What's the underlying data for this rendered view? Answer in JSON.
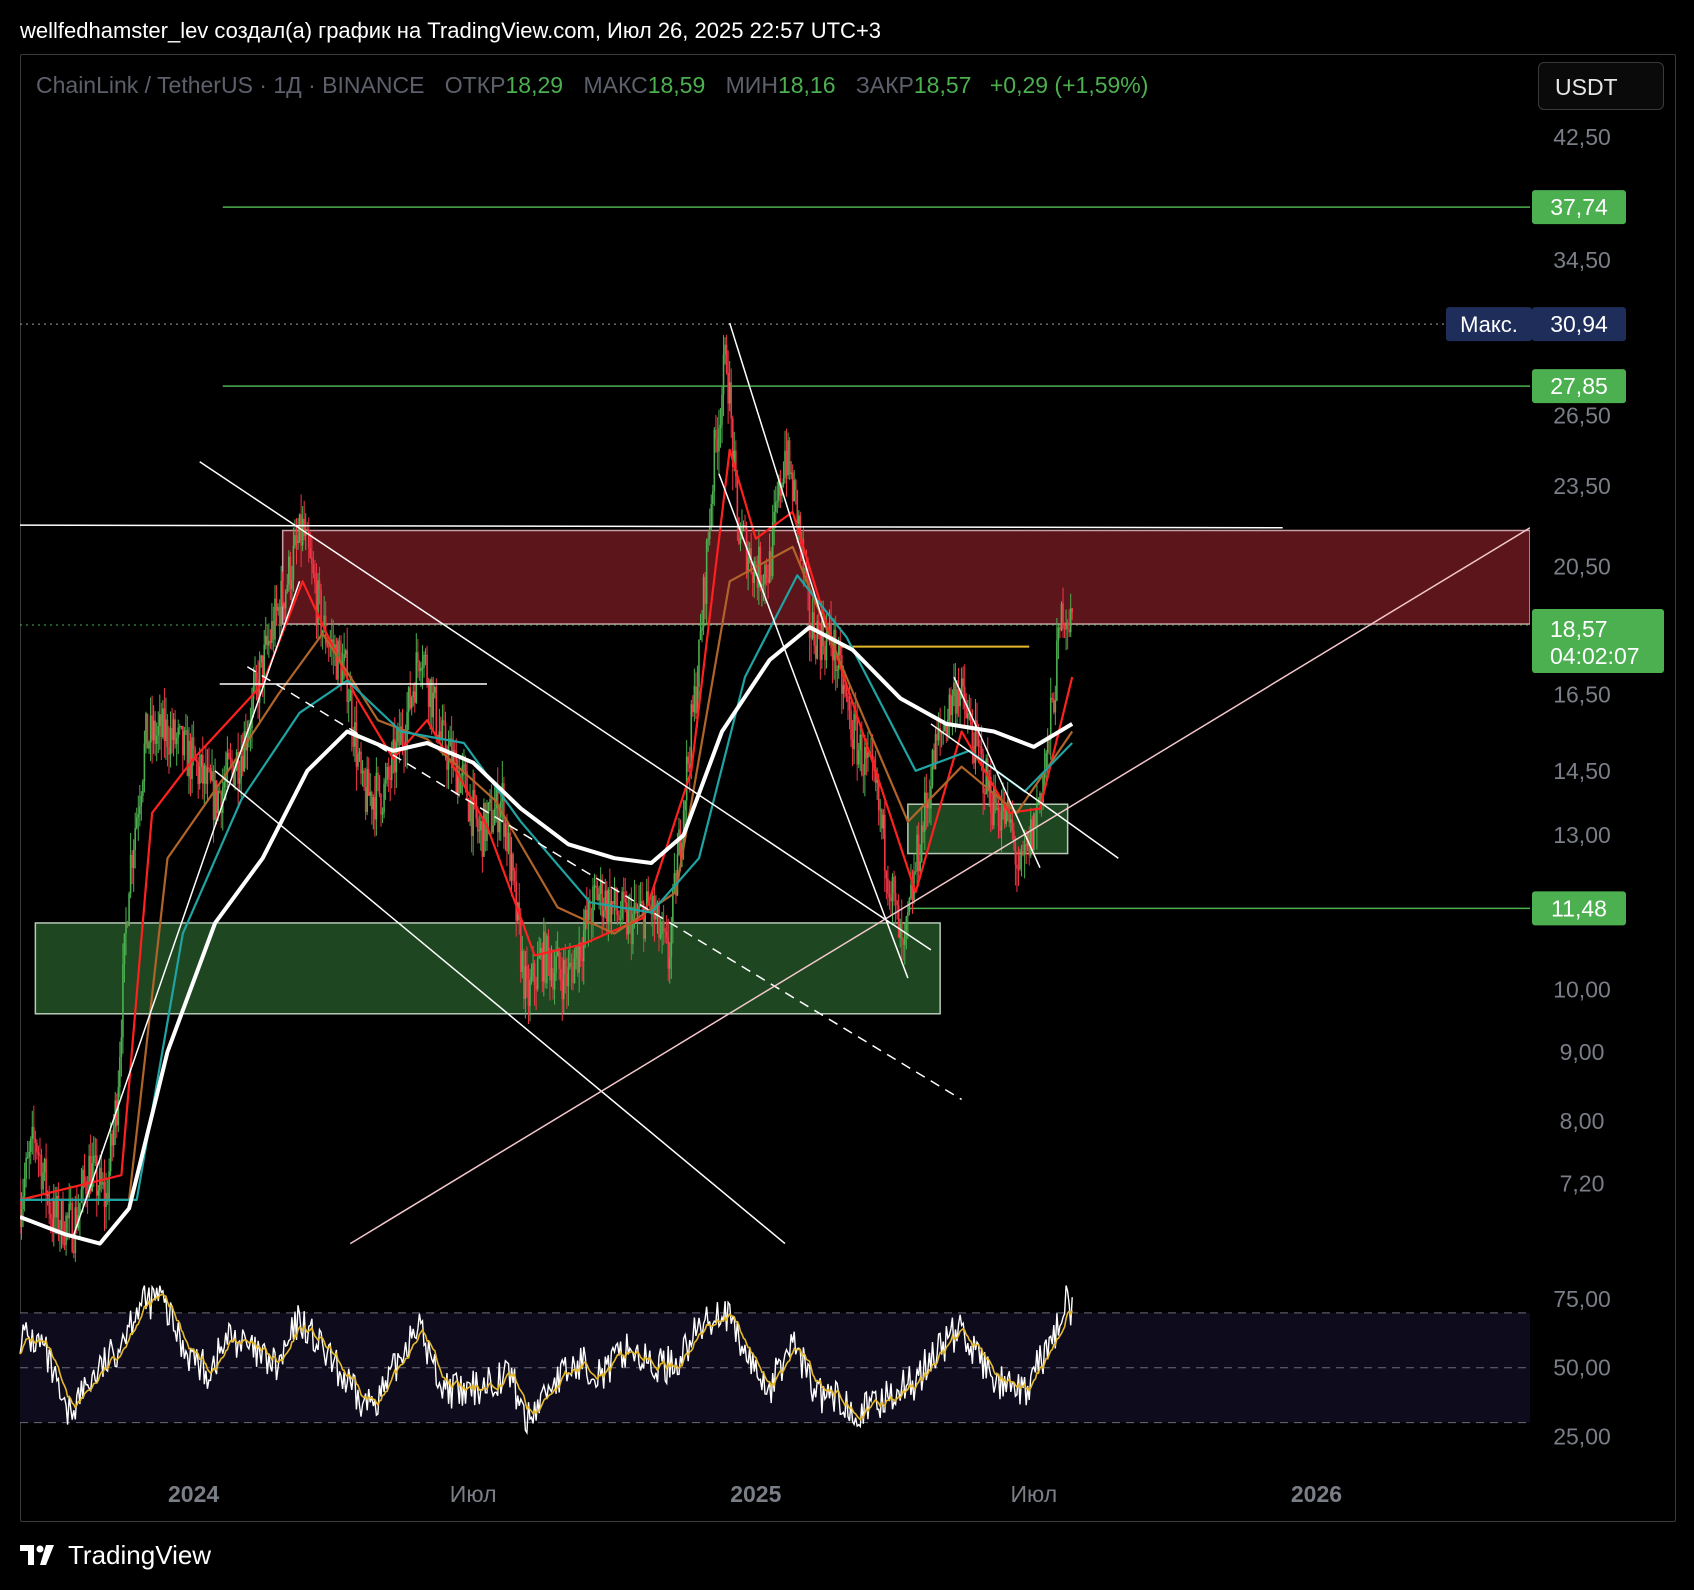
{
  "header": {
    "caption": "wellfedhamster_lev создал(а) график на TradingView.com, Июл 26, 2025 22:57 UTC+3"
  },
  "legend": {
    "symbol": "ChainLink / TetherUS · 1Д · BINANCE",
    "open_label": "ОТКР",
    "open": "18,29",
    "high_label": "МАКС",
    "high": "18,59",
    "low_label": "МИН",
    "low": "18,16",
    "close_label": "ЗАКР",
    "close": "18,57",
    "change": "+0,29 (+1,59%)"
  },
  "currency_button": "USDT",
  "footer": {
    "brand": "TradingView"
  },
  "colors": {
    "up": "#4caf50",
    "down": "#f23645",
    "resistance_zone": "#5c151b",
    "support_zone": "#1e4620",
    "label_green": "#4caf50",
    "label_max": "#1e2d5a",
    "ema_fast": "#ff2020",
    "ema_mid": "#b0642a",
    "ema_slow": "#1fa3a3",
    "ma_white": "#ffffff",
    "rsi_line": "#ffffff",
    "rsi_signal": "#e5b92c",
    "rsi_band": "#0e0c1c"
  },
  "chart_data": {
    "type": "candlestick",
    "title": "",
    "y_scale": "log",
    "y_tick_labels": [
      "42,50",
      "34,50",
      "26,50",
      "23,50",
      "20,50",
      "16,50",
      "14,50",
      "13,00",
      "10,00",
      "9,00",
      "8,00",
      "7,20"
    ],
    "y_ticks": [
      42.5,
      34.5,
      26.5,
      23.5,
      20.5,
      16.5,
      14.5,
      13.0,
      10.0,
      9.0,
      8.0,
      7.2
    ],
    "x_tick_labels": [
      "2024",
      "Июл",
      "2025",
      "Июл",
      "2026"
    ],
    "x_ticks": [
      "2024-01-01",
      "2024-07-01",
      "2025-01-01",
      "2025-07-01",
      "2026-01-01"
    ],
    "x_range": [
      "2023-09-10",
      "2026-05-20"
    ],
    "price_path": [
      [
        "2023-09-10",
        7.0
      ],
      [
        "2023-09-20",
        7.8
      ],
      [
        "2023-10-01",
        6.8
      ],
      [
        "2023-10-15",
        6.7
      ],
      [
        "2023-10-25",
        7.4
      ],
      [
        "2023-11-05",
        7.0
      ],
      [
        "2023-11-12",
        8.3
      ],
      [
        "2023-11-20",
        12.2
      ],
      [
        "2023-12-01",
        15.3
      ],
      [
        "2023-12-15",
        15.5
      ],
      [
        "2024-01-01",
        14.7
      ],
      [
        "2024-01-15",
        13.8
      ],
      [
        "2024-02-01",
        15.0
      ],
      [
        "2024-02-20",
        18.2
      ],
      [
        "2024-03-05",
        20.6
      ],
      [
        "2024-03-12",
        21.8
      ],
      [
        "2024-03-25",
        18.5
      ],
      [
        "2024-04-10",
        17.0
      ],
      [
        "2024-04-20",
        13.9
      ],
      [
        "2024-05-05",
        14.0
      ],
      [
        "2024-05-20",
        16.1
      ],
      [
        "2024-05-28",
        18.0
      ],
      [
        "2024-06-10",
        15.3
      ],
      [
        "2024-06-25",
        14.2
      ],
      [
        "2024-07-05",
        13.0
      ],
      [
        "2024-07-20",
        13.8
      ],
      [
        "2024-08-05",
        9.8
      ],
      [
        "2024-08-15",
        10.6
      ],
      [
        "2024-09-01",
        10.2
      ],
      [
        "2024-09-20",
        11.8
      ],
      [
        "2024-10-10",
        11.2
      ],
      [
        "2024-10-25",
        11.5
      ],
      [
        "2024-11-05",
        10.5
      ],
      [
        "2024-11-15",
        13.8
      ],
      [
        "2024-11-25",
        17.5
      ],
      [
        "2024-12-05",
        24.8
      ],
      [
        "2024-12-13",
        29.5
      ],
      [
        "2024-12-20",
        22.0
      ],
      [
        "2025-01-01",
        20.4
      ],
      [
        "2025-01-10",
        20.5
      ],
      [
        "2025-01-20",
        25.0
      ],
      [
        "2025-01-28",
        22.5
      ],
      [
        "2025-02-05",
        18.5
      ],
      [
        "2025-02-20",
        18.0
      ],
      [
        "2025-03-05",
        15.5
      ],
      [
        "2025-03-20",
        14.0
      ],
      [
        "2025-04-07",
        10.5
      ],
      [
        "2025-04-15",
        12.3
      ],
      [
        "2025-04-28",
        15.0
      ],
      [
        "2025-05-12",
        16.8
      ],
      [
        "2025-05-25",
        15.0
      ],
      [
        "2025-06-05",
        13.7
      ],
      [
        "2025-06-15",
        13.3
      ],
      [
        "2025-06-22",
        12.1
      ],
      [
        "2025-07-01",
        13.2
      ],
      [
        "2025-07-10",
        15.0
      ],
      [
        "2025-07-20",
        19.2
      ],
      [
        "2025-07-26",
        18.57
      ]
    ],
    "moving_averages": [
      {
        "color_key": "ema_fast",
        "points": [
          [
            "2023-09-10",
            7.0
          ],
          [
            "2023-11-15",
            7.3
          ],
          [
            "2023-12-05",
            13.5
          ],
          [
            "2024-01-01",
            14.8
          ],
          [
            "2024-02-15",
            16.8
          ],
          [
            "2024-03-12",
            20.0
          ],
          [
            "2024-04-15",
            16.5
          ],
          [
            "2024-05-10",
            14.8
          ],
          [
            "2024-06-01",
            15.8
          ],
          [
            "2024-07-10",
            13.2
          ],
          [
            "2024-08-10",
            10.6
          ],
          [
            "2024-09-10",
            10.8
          ],
          [
            "2024-10-20",
            11.3
          ],
          [
            "2024-11-20",
            14.5
          ],
          [
            "2024-12-15",
            25.0
          ],
          [
            "2025-01-01",
            21.5
          ],
          [
            "2025-01-25",
            22.5
          ],
          [
            "2025-02-20",
            18.0
          ],
          [
            "2025-03-20",
            14.5
          ],
          [
            "2025-04-15",
            11.8
          ],
          [
            "2025-05-15",
            15.5
          ],
          [
            "2025-06-15",
            13.5
          ],
          [
            "2025-07-05",
            13.6
          ],
          [
            "2025-07-26",
            17.0
          ]
        ]
      },
      {
        "color_key": "ema_mid",
        "points": [
          [
            "2023-09-10",
            7.0
          ],
          [
            "2023-11-20",
            7.0
          ],
          [
            "2023-12-15",
            12.5
          ],
          [
            "2024-01-20",
            14.3
          ],
          [
            "2024-02-25",
            16.5
          ],
          [
            "2024-03-25",
            18.3
          ],
          [
            "2024-04-30",
            15.8
          ],
          [
            "2024-06-01",
            15.3
          ],
          [
            "2024-07-15",
            13.8
          ],
          [
            "2024-08-25",
            11.5
          ],
          [
            "2024-10-01",
            11.0
          ],
          [
            "2024-11-10",
            11.8
          ],
          [
            "2024-12-15",
            20.0
          ],
          [
            "2025-01-25",
            21.2
          ],
          [
            "2025-03-01",
            17.0
          ],
          [
            "2025-04-10",
            13.3
          ],
          [
            "2025-05-15",
            14.6
          ],
          [
            "2025-06-20",
            13.5
          ],
          [
            "2025-07-26",
            15.5
          ]
        ]
      },
      {
        "color_key": "ema_slow",
        "points": [
          [
            "2023-09-10",
            7.0
          ],
          [
            "2023-11-25",
            7.0
          ],
          [
            "2023-12-25",
            11.0
          ],
          [
            "2024-02-01",
            13.8
          ],
          [
            "2024-03-10",
            16.0
          ],
          [
            "2024-04-10",
            16.9
          ],
          [
            "2024-05-15",
            15.5
          ],
          [
            "2024-06-25",
            15.2
          ],
          [
            "2024-08-01",
            13.3
          ],
          [
            "2024-09-15",
            11.6
          ],
          [
            "2024-10-25",
            11.4
          ],
          [
            "2024-11-25",
            12.5
          ],
          [
            "2024-12-25",
            17.0
          ],
          [
            "2025-01-28",
            20.2
          ],
          [
            "2025-03-01",
            18.2
          ],
          [
            "2025-04-15",
            14.5
          ],
          [
            "2025-05-20",
            15.0
          ],
          [
            "2025-06-25",
            14.0
          ],
          [
            "2025-07-26",
            15.2
          ]
        ]
      },
      {
        "color_key": "ma_white",
        "points": [
          [
            "2023-09-10",
            6.8
          ],
          [
            "2023-10-10",
            6.6
          ],
          [
            "2023-11-01",
            6.5
          ],
          [
            "2023-11-20",
            6.9
          ],
          [
            "2023-12-15",
            9.0
          ],
          [
            "2024-01-15",
            11.2
          ],
          [
            "2024-02-15",
            12.5
          ],
          [
            "2024-03-15",
            14.5
          ],
          [
            "2024-04-10",
            15.5
          ],
          [
            "2024-05-10",
            15.0
          ],
          [
            "2024-06-01",
            15.2
          ],
          [
            "2024-07-01",
            14.7
          ],
          [
            "2024-08-01",
            13.6
          ],
          [
            "2024-09-01",
            12.8
          ],
          [
            "2024-10-01",
            12.5
          ],
          [
            "2024-10-25",
            12.4
          ],
          [
            "2024-11-15",
            13.0
          ],
          [
            "2024-12-10",
            15.5
          ],
          [
            "2025-01-10",
            17.5
          ],
          [
            "2025-02-05",
            18.5
          ],
          [
            "2025-03-05",
            17.8
          ],
          [
            "2025-04-05",
            16.4
          ],
          [
            "2025-05-05",
            15.7
          ],
          [
            "2025-06-05",
            15.5
          ],
          [
            "2025-07-01",
            15.1
          ],
          [
            "2025-07-26",
            15.7
          ]
        ]
      }
    ],
    "horizontal_lines": [
      {
        "price": 37.74,
        "start": "2024-01-20",
        "label": "37,74",
        "style": "green"
      },
      {
        "price": 27.85,
        "start": "2024-01-20",
        "label": "27,85",
        "style": "green"
      },
      {
        "price": 11.48,
        "start": "2025-04-10",
        "label": "11,48",
        "style": "green"
      }
    ],
    "max_marker": {
      "price": 30.94,
      "prefix": "Макс.",
      "label": "30,94"
    },
    "current_price": {
      "price": 18.57,
      "label": "18,57",
      "countdown": "04:02:07"
    },
    "zones": [
      {
        "kind": "resistance",
        "from": "2024-02-28",
        "to": "2026-05-20",
        "low": 18.6,
        "high": 21.8
      },
      {
        "kind": "support",
        "from": "2023-09-20",
        "to": "2025-05-01",
        "low": 9.6,
        "high": 11.2
      },
      {
        "kind": "support",
        "from": "2025-04-10",
        "to": "2025-07-23",
        "low": 12.6,
        "high": 13.7
      }
    ],
    "trendlines": [
      {
        "from": [
          "2023-09-10",
          22.0
        ],
        "to": [
          "2025-12-10",
          21.9
        ],
        "style": "solid"
      },
      {
        "from": [
          "2024-01-05",
          24.5
        ],
        "to": [
          "2025-04-25",
          10.7
        ],
        "style": "solid"
      },
      {
        "from": [
          "2024-01-15",
          14.5
        ],
        "to": [
          "2025-01-20",
          6.5
        ],
        "style": "solid"
      },
      {
        "from": [
          "2024-02-05",
          17.3
        ],
        "to": [
          "2025-05-15",
          8.3
        ],
        "style": "dashed"
      },
      {
        "from": [
          "2024-04-12",
          6.5
        ],
        "to": [
          "2026-05-20",
          21.9
        ],
        "style": "solid"
      },
      {
        "from": [
          "2023-10-15",
          6.6
        ],
        "to": [
          "2024-03-10",
          20.0
        ],
        "style": "solid"
      },
      {
        "from": [
          "2024-12-08",
          24.0
        ],
        "to": [
          "2025-04-10",
          10.2
        ],
        "style": "solid"
      },
      {
        "from": [
          "2024-12-15",
          31.0
        ],
        "to": [
          "2025-02-15",
          18.5
        ],
        "style": "solid"
      },
      {
        "from": [
          "2024-01-18",
          16.8
        ],
        "to": [
          "2024-07-10",
          16.8
        ],
        "style": "solid"
      },
      {
        "from": [
          "2025-04-25",
          15.7
        ],
        "to": [
          "2025-08-25",
          12.5
        ],
        "style": "solid"
      },
      {
        "from": [
          "2025-05-10",
          17.0
        ],
        "to": [
          "2025-07-05",
          12.3
        ],
        "style": "solid"
      }
    ],
    "yellow_level": {
      "price": 17.9,
      "from": "2025-02-25",
      "to": "2025-06-28"
    },
    "rsi": {
      "tick_labels": [
        "75,00",
        "50,00",
        "25,00"
      ],
      "ticks": [
        75,
        50,
        25
      ],
      "band": [
        30,
        70
      ],
      "range": [
        20,
        82
      ],
      "path": [
        [
          "2023-09-10",
          62
        ],
        [
          "2023-09-25",
          58
        ],
        [
          "2023-10-10",
          32
        ],
        [
          "2023-10-25",
          45
        ],
        [
          "2023-11-10",
          55
        ],
        [
          "2023-11-25",
          72
        ],
        [
          "2023-12-10",
          76
        ],
        [
          "2023-12-25",
          58
        ],
        [
          "2024-01-10",
          48
        ],
        [
          "2024-01-25",
          62
        ],
        [
          "2024-02-10",
          55
        ],
        [
          "2024-02-25",
          50
        ],
        [
          "2024-03-10",
          68
        ],
        [
          "2024-03-20",
          60
        ],
        [
          "2024-04-05",
          48
        ],
        [
          "2024-04-20",
          36
        ],
        [
          "2024-05-05",
          42
        ],
        [
          "2024-05-25",
          67
        ],
        [
          "2024-06-10",
          44
        ],
        [
          "2024-06-25",
          40
        ],
        [
          "2024-07-10",
          45
        ],
        [
          "2024-07-25",
          48
        ],
        [
          "2024-08-05",
          30
        ],
        [
          "2024-08-20",
          44
        ],
        [
          "2024-09-10",
          52
        ],
        [
          "2024-09-25",
          48
        ],
        [
          "2024-10-10",
          58
        ],
        [
          "2024-10-25",
          50
        ],
        [
          "2024-11-10",
          52
        ],
        [
          "2024-11-25",
          64
        ],
        [
          "2024-12-10",
          72
        ],
        [
          "2024-12-25",
          55
        ],
        [
          "2025-01-10",
          42
        ],
        [
          "2025-01-25",
          60
        ],
        [
          "2025-02-10",
          40
        ],
        [
          "2025-02-25",
          38
        ],
        [
          "2025-03-15",
          34
        ],
        [
          "2025-04-01",
          42
        ],
        [
          "2025-04-15",
          45
        ],
        [
          "2025-05-01",
          58
        ],
        [
          "2025-05-15",
          64
        ],
        [
          "2025-06-01",
          48
        ],
        [
          "2025-06-15",
          42
        ],
        [
          "2025-06-25",
          40
        ],
        [
          "2025-07-05",
          52
        ],
        [
          "2025-07-15",
          62
        ],
        [
          "2025-07-22",
          78
        ],
        [
          "2025-07-26",
          70
        ]
      ]
    }
  }
}
